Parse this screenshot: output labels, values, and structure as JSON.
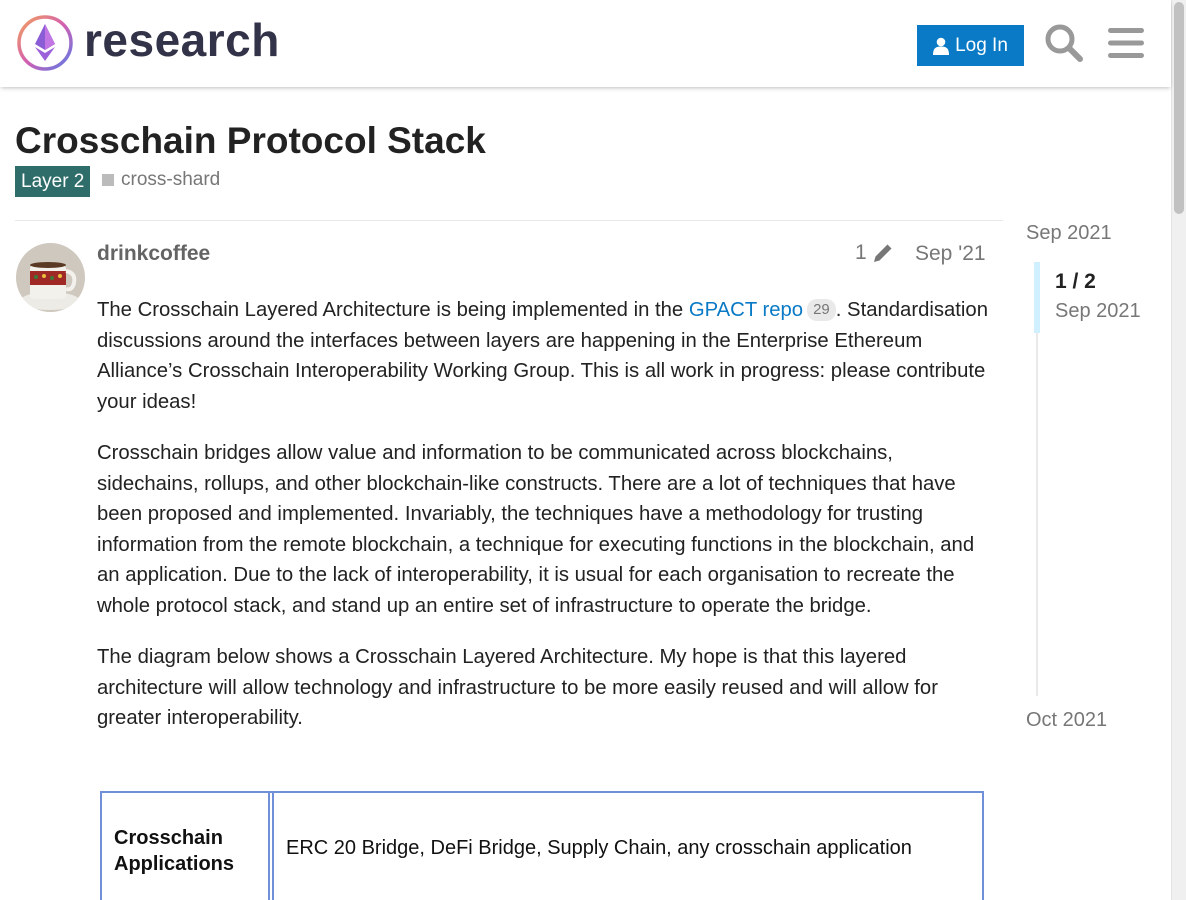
{
  "header": {
    "logo_text": "research",
    "login_label": "Log In"
  },
  "topic": {
    "title": "Crosschain Protocol Stack",
    "category": "Layer 2",
    "tag": "cross-shard"
  },
  "post": {
    "username": "drinkcoffee",
    "edit_count": "1",
    "date": "Sep '21",
    "p1_before": "The Crosschain Layered Architecture is being implemented in the ",
    "p1_link": "GPACT repo",
    "p1_link_clicks": "29",
    "p1_after": ". Standardisation discussions around the interfaces between layers are happening in the Enterprise Ethereum Alliance’s Crosschain Interoperability Working Group. This is all work in progress: please contribute your ideas!",
    "p2": "Crosschain bridges allow value and information to be communicated across blockchains, sidechains, rollups, and other blockchain-like constructs. There are a lot of techniques that have been proposed and implemented. Invariably, the techniques have a methodology for trusting information from the remote blockchain, a technique for executing functions in the blockchain, and an application. Due to the lack of interoperability, it is usual for each organisation to recreate the whole protocol stack, and stand up an entire set of infrastructure to operate the bridge.",
    "p3": "The diagram below shows a Crosschain Layered Architecture. My hope is that this layered architecture will allow technology and infrastructure to be more easily reused and will allow for greater interoperability."
  },
  "diagram": {
    "layer_name": "Crosschain Applications",
    "layer_desc": "ERC 20 Bridge, DeFi Bridge, Supply Chain, any crosschain application"
  },
  "timeline": {
    "start": "Sep 2021",
    "position": "1 / 2",
    "position_date": "Sep 2021",
    "end": "Oct 2021"
  },
  "colors": {
    "accent": "#0a7ac6",
    "category": "#2f6d6a",
    "timeline_handle": "#d1f0ff"
  }
}
